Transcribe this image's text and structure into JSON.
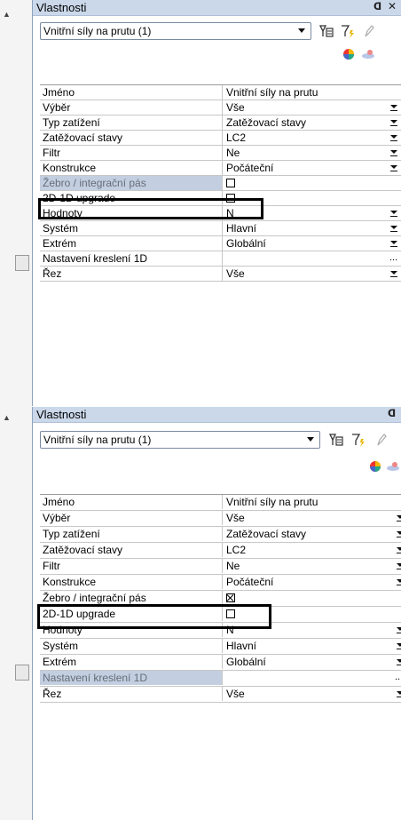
{
  "colors": {
    "titlebar": "#cbd8ea",
    "selected_row": "#c3cfe0",
    "highlight_border": "#000000"
  },
  "panels": [
    {
      "title": "Vlastnosti",
      "pin_icon": "pin-icon",
      "close_icon": "close-icon",
      "combo_value": "Vnitřní síly na prutu (1)",
      "toolbar_icons": [
        "select-filter-icon",
        "filter-icon",
        "edit-icon",
        "color-palette-icon",
        "pin-action-icon"
      ],
      "rows": [
        {
          "label": "Jméno",
          "value": "Vnitřní síly na prutu",
          "control": "text"
        },
        {
          "label": "Výběr",
          "value": "Vše",
          "control": "dropdown"
        },
        {
          "label": "Typ zatížení",
          "value": "Zatěžovací stavy",
          "control": "dropdown"
        },
        {
          "label": "Zatěžovací stavy",
          "value": "LC2",
          "control": "dropdown"
        },
        {
          "label": "Filtr",
          "value": "Ne",
          "control": "dropdown"
        },
        {
          "label": "Konstrukce",
          "value": "Počáteční",
          "control": "dropdown"
        },
        {
          "label": "Žebro / integrační pás",
          "value": "",
          "control": "checkbox",
          "checked": false,
          "selected": true
        },
        {
          "label": "2D-1D upgrade",
          "value": "",
          "control": "checkbox",
          "checked": false
        },
        {
          "label": "Hodnoty",
          "value": "N",
          "control": "dropdown"
        },
        {
          "label": "Systém",
          "value": "Hlavní",
          "control": "dropdown"
        },
        {
          "label": "Extrém",
          "value": "Globální",
          "control": "dropdown"
        },
        {
          "label": "Nastavení kreslení 1D",
          "value": "",
          "control": "ellipsis",
          "ellipsis": "..."
        },
        {
          "label": "Řez",
          "value": "Vše",
          "control": "dropdown"
        }
      ]
    },
    {
      "title": "Vlastnosti",
      "pin_icon": "pin-icon",
      "combo_value": "Vnitřní síly na prutu (1)",
      "toolbar_icons": [
        "select-filter-icon",
        "filter-icon",
        "edit-icon",
        "color-palette-icon",
        "pin-action-icon"
      ],
      "rows": [
        {
          "label": "Jméno",
          "value": "Vnitřní síly na prutu",
          "control": "text"
        },
        {
          "label": "Výběr",
          "value": "Vše",
          "control": "dropdown"
        },
        {
          "label": "Typ zatížení",
          "value": "Zatěžovací stavy",
          "control": "dropdown"
        },
        {
          "label": "Zatěžovací stavy",
          "value": "LC2",
          "control": "dropdown"
        },
        {
          "label": "Filtr",
          "value": "Ne",
          "control": "dropdown"
        },
        {
          "label": "Konstrukce",
          "value": "Počáteční",
          "control": "dropdown"
        },
        {
          "label": "Žebro / integrační pás",
          "value": "",
          "control": "checkbox",
          "checked": true
        },
        {
          "label": "2D-1D upgrade",
          "value": "",
          "control": "checkbox",
          "checked": false
        },
        {
          "label": "Hodnoty",
          "value": "N",
          "control": "dropdown"
        },
        {
          "label": "Systém",
          "value": "Hlavní",
          "control": "dropdown"
        },
        {
          "label": "Extrém",
          "value": "Globální",
          "control": "dropdown"
        },
        {
          "label": "Nastavení kreslení 1D",
          "value": "",
          "control": "ellipsis",
          "ellipsis": "...",
          "selected": true
        },
        {
          "label": "Řez",
          "value": "Vše",
          "control": "dropdown"
        }
      ]
    }
  ]
}
